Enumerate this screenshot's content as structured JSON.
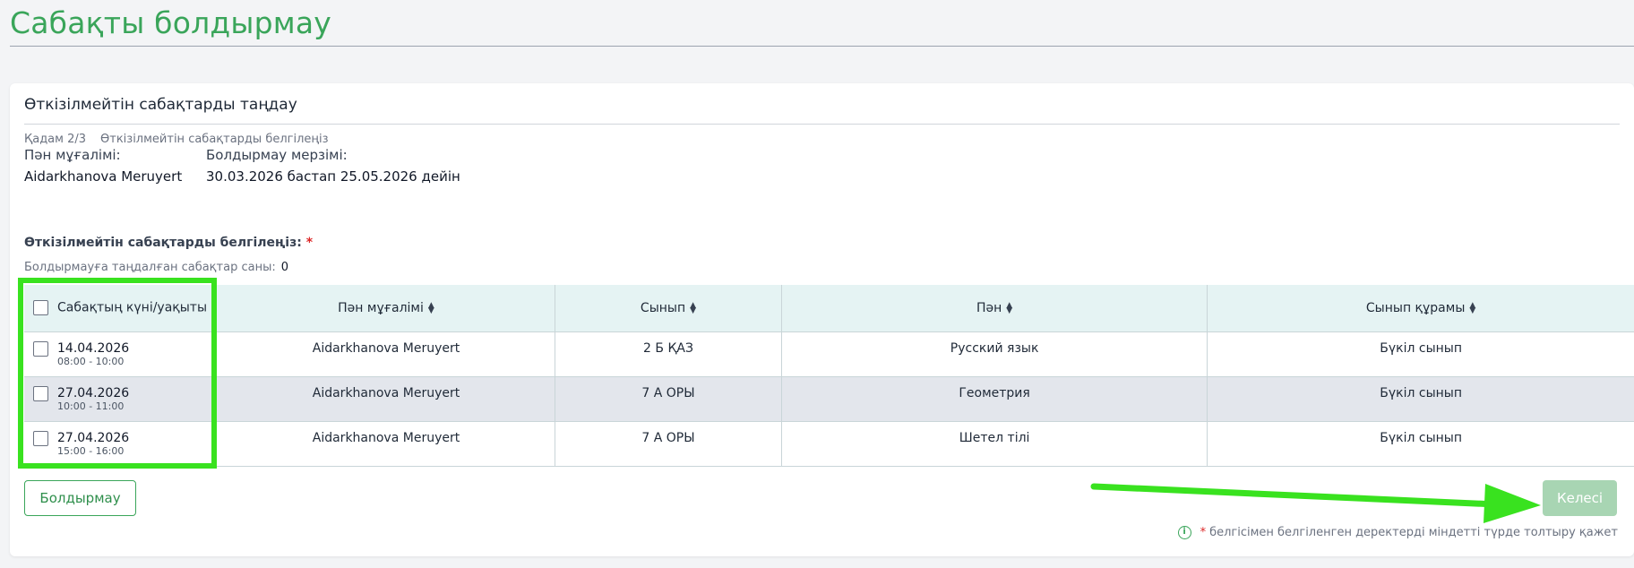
{
  "page": {
    "title": "Сабақты болдырмау"
  },
  "card": {
    "title": "Өткізілмейтін сабақтарды таңдау",
    "step": "Қадам 2/3",
    "step_desc": "Өткізілмейтін сабақтарды белгілеңіз",
    "teacher_label": "Пән мұғалімі:",
    "teacher_value": "Aidarkhanova Meruyert",
    "period_label": "Болдырмау мерзімі:",
    "period_value": "30.03.2026 бастап 25.05.2026 дейін",
    "section_label": "Өткізілмейтін сабақтарды белгілеңіз:",
    "required_mark": "*",
    "count_label": "Болдырмауға таңдалған сабақтар саны:",
    "count_value": "0"
  },
  "table": {
    "columns": [
      {
        "label": "Сабақтың күні/уақыты"
      },
      {
        "label": "Пән мұғалімі"
      },
      {
        "label": "Сынып"
      },
      {
        "label": "Пән"
      },
      {
        "label": "Сынып құрамы"
      }
    ],
    "rows": [
      {
        "date": "14.04.2026",
        "time": "08:00 - 10:00",
        "teacher": "Aidarkhanova Meruyert",
        "class": "2 Б ҚАЗ",
        "subject": "Русский язык",
        "group": "Бүкіл сынып"
      },
      {
        "date": "27.04.2026",
        "time": "10:00 - 11:00",
        "teacher": "Aidarkhanova Meruyert",
        "class": "7 А ОРЫ",
        "subject": "Геометрия",
        "group": "Бүкіл сынып"
      },
      {
        "date": "27.04.2026",
        "time": "15:00 - 16:00",
        "teacher": "Aidarkhanova Meruyert",
        "class": "7 А ОРЫ",
        "subject": "Шетел тілі",
        "group": "Бүкіл сынып"
      }
    ]
  },
  "actions": {
    "cancel_label": "Болдырмау",
    "next_label": "Келесі"
  },
  "footnote": {
    "star": "*",
    "text": "белгісімен белгіленген деректерді міндетті түрде толтыру қажет"
  },
  "colors": {
    "accent": "#3aa55a",
    "annotation": "#39e21f",
    "header_bg": "#e5f3f3",
    "row_alt": "#e3e6ec",
    "next_disabled": "#a8d5b3"
  },
  "icons": {
    "sort": "sort-icon",
    "info": "info-icon",
    "checkbox": "checkbox-icon"
  }
}
